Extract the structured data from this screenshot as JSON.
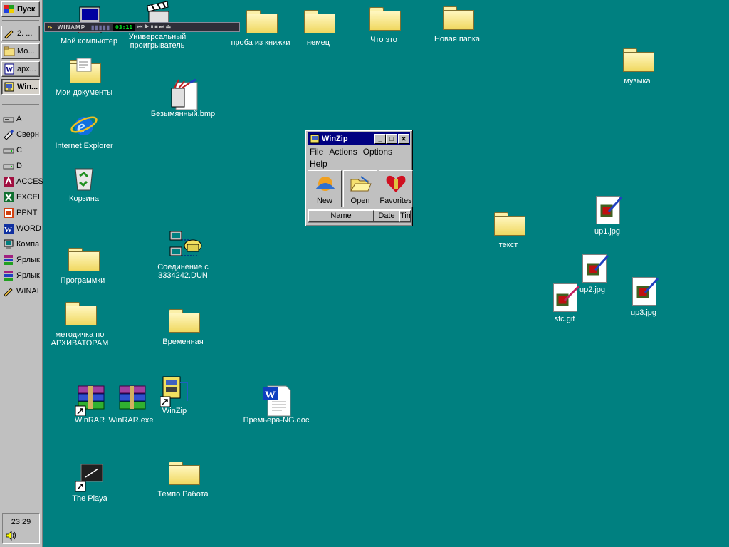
{
  "taskbar": {
    "start_label": "Пуск",
    "tasks": [
      {
        "label": "2. ...",
        "icon": "pencil-icon"
      },
      {
        "label": "Мо...",
        "icon": "folder-icon"
      },
      {
        "label": "арх...",
        "icon": "word-doc-icon"
      },
      {
        "label": "Win...",
        "icon": "winzip-icon",
        "active": true
      }
    ],
    "quick_launch": [
      {
        "label": "A",
        "icon": "floppy-drive-icon"
      },
      {
        "label": "Сверн",
        "icon": "minimize-all-icon"
      },
      {
        "label": "C",
        "icon": "hard-drive-icon"
      },
      {
        "label": "D",
        "icon": "hard-drive-icon"
      },
      {
        "label": "ACCES",
        "icon": "access-icon"
      },
      {
        "label": "EXCEL",
        "icon": "excel-icon"
      },
      {
        "label": "PPNT",
        "icon": "powerpoint-icon"
      },
      {
        "label": "WORD",
        "icon": "word-icon"
      },
      {
        "label": "Компа",
        "icon": "computer-icon"
      },
      {
        "label": "Ярлык",
        "icon": "winrar-icon"
      },
      {
        "label": "Ярлык",
        "icon": "winrar-icon"
      },
      {
        "label": "WINAI",
        "icon": "winamp-icon"
      }
    ],
    "clock": "23:29"
  },
  "winamp": {
    "brand": "WINAMP",
    "time": "03:11"
  },
  "desktop": {
    "my_computer": "Мой компьютер",
    "player": "Универсальный проигрыватель",
    "my_documents": "Мои документы",
    "ie": "Internet Explorer",
    "recycle": "Корзина",
    "programs": "Программки",
    "method": "методичка по АРХИВАТОРАМ",
    "winrar": "WinRAR",
    "winrar_exe": "WinRAR.exe",
    "winzip": "WinZip",
    "playa": "The Playa",
    "bmp": "Безымянный.bmp",
    "dun": "Соединение с 3334242.DUN",
    "temp": "Временная",
    "tempo": "Темпо Работа",
    "doc": "Премьера-NG.doc",
    "proba": "проба из книжки",
    "nemets": "немец",
    "chto": "Что это",
    "new_folder": "Новая папка",
    "music": "музыка",
    "text": "текст",
    "up1": "up1.jpg",
    "up2": "up2.jpg",
    "sfc": "sfc.gif",
    "up3": "up3.jpg"
  },
  "winzip_window": {
    "title": "WinZip",
    "menu": [
      "File",
      "Actions",
      "Options",
      "Help"
    ],
    "toolbar": [
      "New",
      "Open",
      "Favorites"
    ],
    "columns": [
      "Name",
      "Date",
      "Tim"
    ]
  },
  "colors": {
    "desktop": "#008080",
    "face": "#c0c0c0",
    "titlebar": "#000080"
  }
}
